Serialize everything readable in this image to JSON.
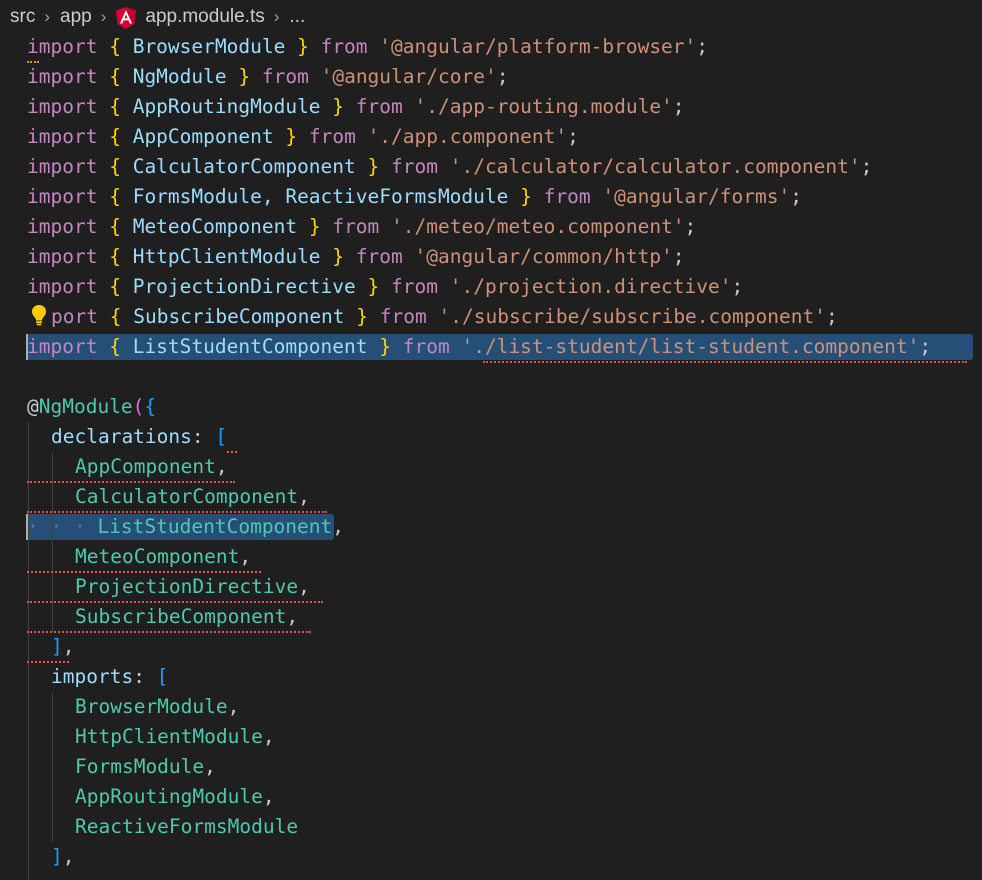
{
  "breadcrumb": {
    "items": [
      "src",
      "app",
      "app.module.ts",
      "..."
    ],
    "file_icon": "angular-icon",
    "separator_icon": "chevron-right-icon"
  },
  "code": {
    "imports": [
      {
        "kw": "import",
        "names": "BrowserModule",
        "from": "from",
        "path": "'@angular/platform-browser'"
      },
      {
        "kw": "import",
        "names": "NgModule",
        "from": "from",
        "path": "'@angular/core'"
      },
      {
        "kw": "import",
        "names": "AppRoutingModule",
        "from": "from",
        "path": "'./app-routing.module'"
      },
      {
        "kw": "import",
        "names": "AppComponent",
        "from": "from",
        "path": "'./app.component'"
      },
      {
        "kw": "import",
        "names": "CalculatorComponent",
        "from": "from",
        "path": "'./calculator/calculator.component'"
      },
      {
        "kw": "import",
        "names": "FormsModule, ReactiveFormsModule",
        "from": "from",
        "path": "'@angular/forms'"
      },
      {
        "kw": "import",
        "names": "MeteoComponent",
        "from": "from",
        "path": "'./meteo/meteo.component'"
      },
      {
        "kw": "import",
        "names": "HttpClientModule",
        "from": "from",
        "path": "'@angular/common/http'"
      },
      {
        "kw": "import",
        "names": "ProjectionDirective",
        "from": "from",
        "path": "'./projection.directive'"
      },
      {
        "kw": "port",
        "names": "SubscribeComponent",
        "from": "from",
        "path": "'./subscribe/subscribe.component'"
      },
      {
        "kw": "import",
        "names": "ListStudentComponent",
        "from": "from",
        "path": "'./list-student/list-student.component'"
      }
    ],
    "decorator": "@",
    "decorator_name": "NgModule",
    "declarations_key": "declarations",
    "declarations": [
      "AppComponent",
      "CalculatorComponent",
      "ListStudentComponent",
      "MeteoComponent",
      "ProjectionDirective",
      "SubscribeComponent"
    ],
    "imports_key": "imports",
    "imports_list": [
      "BrowserModule",
      "HttpClientModule",
      "FormsModule",
      "AppRoutingModule",
      "ReactiveFormsModule"
    ],
    "lightbulb_icon": "lightbulb-icon"
  }
}
